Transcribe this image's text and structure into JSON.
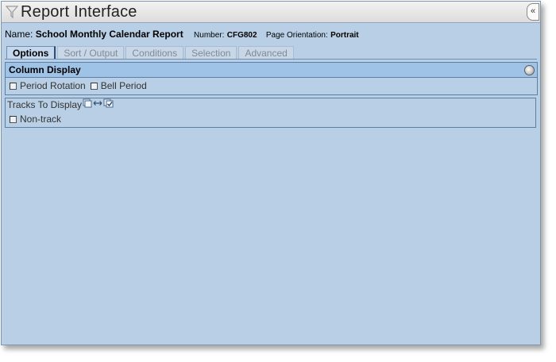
{
  "window": {
    "title": "Report Interface",
    "collapse_label": "«"
  },
  "report": {
    "name_label": "Name:",
    "name_value": "School Monthly Calendar Report",
    "number_label": "Number:",
    "number_value": "CFG802",
    "orientation_label": "Page Orientation:",
    "orientation_value": "Portrait"
  },
  "tabs": [
    {
      "label": "Options",
      "active": true
    },
    {
      "label": "Sort / Output",
      "active": false
    },
    {
      "label": "Conditions",
      "active": false
    },
    {
      "label": "Selection",
      "active": false
    },
    {
      "label": "Advanced",
      "active": false
    }
  ],
  "column_display": {
    "title": "Column Display",
    "options": [
      {
        "label": "Period Rotation",
        "checked": false
      },
      {
        "label": "Bell Period",
        "checked": false
      }
    ]
  },
  "tracks": {
    "title": "Tracks To Display",
    "options": [
      {
        "label": "Non-track",
        "checked": false
      }
    ]
  },
  "icons": [
    "filter-icon",
    "collapse-icon",
    "info-circle-icon",
    "select-none-icon",
    "swap-icon",
    "select-all-icon"
  ]
}
